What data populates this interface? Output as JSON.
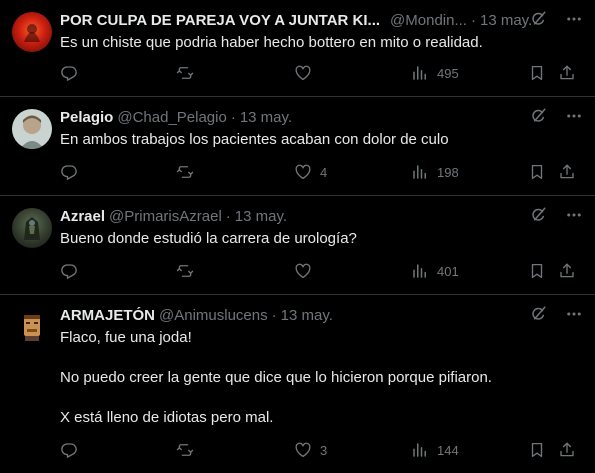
{
  "tweets": [
    {
      "name": "POR CULPA DE PAREJA VOY A JUNTAR KI...",
      "handle": "@Mondin...",
      "time": "13 may.",
      "lines": [
        "Es un chiste que podria haber hecho bottero en mito o realidad."
      ],
      "replies": "",
      "retweets": "",
      "likes": "",
      "views": "495"
    },
    {
      "name": "Pelagio",
      "handle": "@Chad_Pelagio",
      "time": "13 may.",
      "lines": [
        "En ambos trabajos los pacientes acaban con dolor de culo"
      ],
      "replies": "",
      "retweets": "",
      "likes": "4",
      "views": "198"
    },
    {
      "name": "Azrael",
      "handle": "@PrimarisAzrael",
      "time": "13 may.",
      "lines": [
        "Bueno donde estudió la carrera de urología?"
      ],
      "replies": "",
      "retweets": "",
      "likes": "",
      "views": "401"
    },
    {
      "name": "ARMAJETÓN",
      "handle": "@Animuslucens",
      "time": "13 may.",
      "lines": [
        "Flaco, fue una joda!",
        "No puedo creer la gente que dice que lo hicieron porque pifiaron.",
        "X está lleno de idiotas pero mal."
      ],
      "replies": "",
      "retweets": "",
      "likes": "3",
      "views": "144"
    }
  ],
  "icons": {
    "grok": "grok-icon",
    "more": "more-icon",
    "reply": "reply-icon",
    "retweet": "retweet-icon",
    "like": "like-icon",
    "views": "views-icon",
    "bookmark": "bookmark-icon",
    "share": "share-icon"
  },
  "colors": {
    "background": "#000000",
    "text": "#e7e9ea",
    "muted": "#71767b",
    "border": "#2f3336"
  }
}
